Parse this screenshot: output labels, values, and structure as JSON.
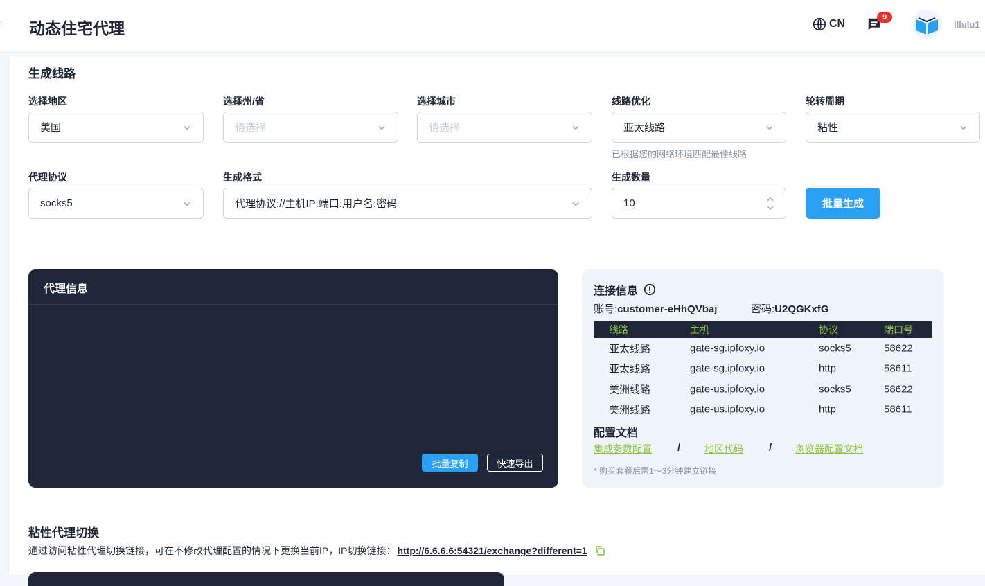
{
  "header": {
    "edge_mark": "!",
    "title": "动态住宅代理",
    "language": "CN",
    "notification_count": "9",
    "username": "llluIu1"
  },
  "form": {
    "section_title": "生成线路",
    "region": {
      "label": "选择地区",
      "value": "美国"
    },
    "state": {
      "label": "选择州/省",
      "placeholder": "请选择"
    },
    "city": {
      "label": "选择城市",
      "placeholder": "请选择"
    },
    "route": {
      "label": "线路优化",
      "value": "亚太线路",
      "hint": "已根据您的网络环境匹配最佳线路"
    },
    "rotation": {
      "label": "轮转周期",
      "value": "粘性"
    },
    "protocol": {
      "label": "代理协议",
      "value": "socks5"
    },
    "format": {
      "label": "生成格式",
      "value": "代理协议://主机IP:端口:用户名:密码"
    },
    "quantity": {
      "label": "生成数量",
      "value": "10"
    },
    "generate_button": "批量生成"
  },
  "proxy_panel": {
    "title": "代理信息",
    "copy_button": "批量复制",
    "export_button": "快速导出"
  },
  "connection": {
    "title": "连接信息",
    "account_label": "账号:",
    "account_value": "customer-eHhQVbaj",
    "password_label": "密码:",
    "password_value": "U2QGKxfG",
    "columns": [
      "线路",
      "主机",
      "协议",
      "端口号"
    ],
    "rows": [
      [
        "亚太线路",
        "gate-sg.ipfoxy.io",
        "socks5",
        "58622"
      ],
      [
        "亚太线路",
        "gate-sg.ipfoxy.io",
        "http",
        "58611"
      ],
      [
        "美洲线路",
        "gate-us.ipfoxy.io",
        "socks5",
        "58622"
      ],
      [
        "美洲线路",
        "gate-us.ipfoxy.io",
        "http",
        "58611"
      ]
    ],
    "docs_title": "配置文档",
    "doc_links": [
      "集成参数配置",
      "地区代码",
      "浏览器配置文档"
    ],
    "separator": "/",
    "note": "* 购买套餐后需1～3分钟建立链接"
  },
  "sticky": {
    "title": "粘性代理切换",
    "description": "通过访问粘性代理切换链接，可在不修改代理配置的情况下更换当前IP，IP切换链接：",
    "link": "http://6.6.6.6:54321/exchange?different=1"
  },
  "colors": {
    "accent": "#2aa0f5",
    "dark_panel": "#1f2638",
    "link_green": "#8cc43a",
    "badge_red": "#e8302d"
  }
}
